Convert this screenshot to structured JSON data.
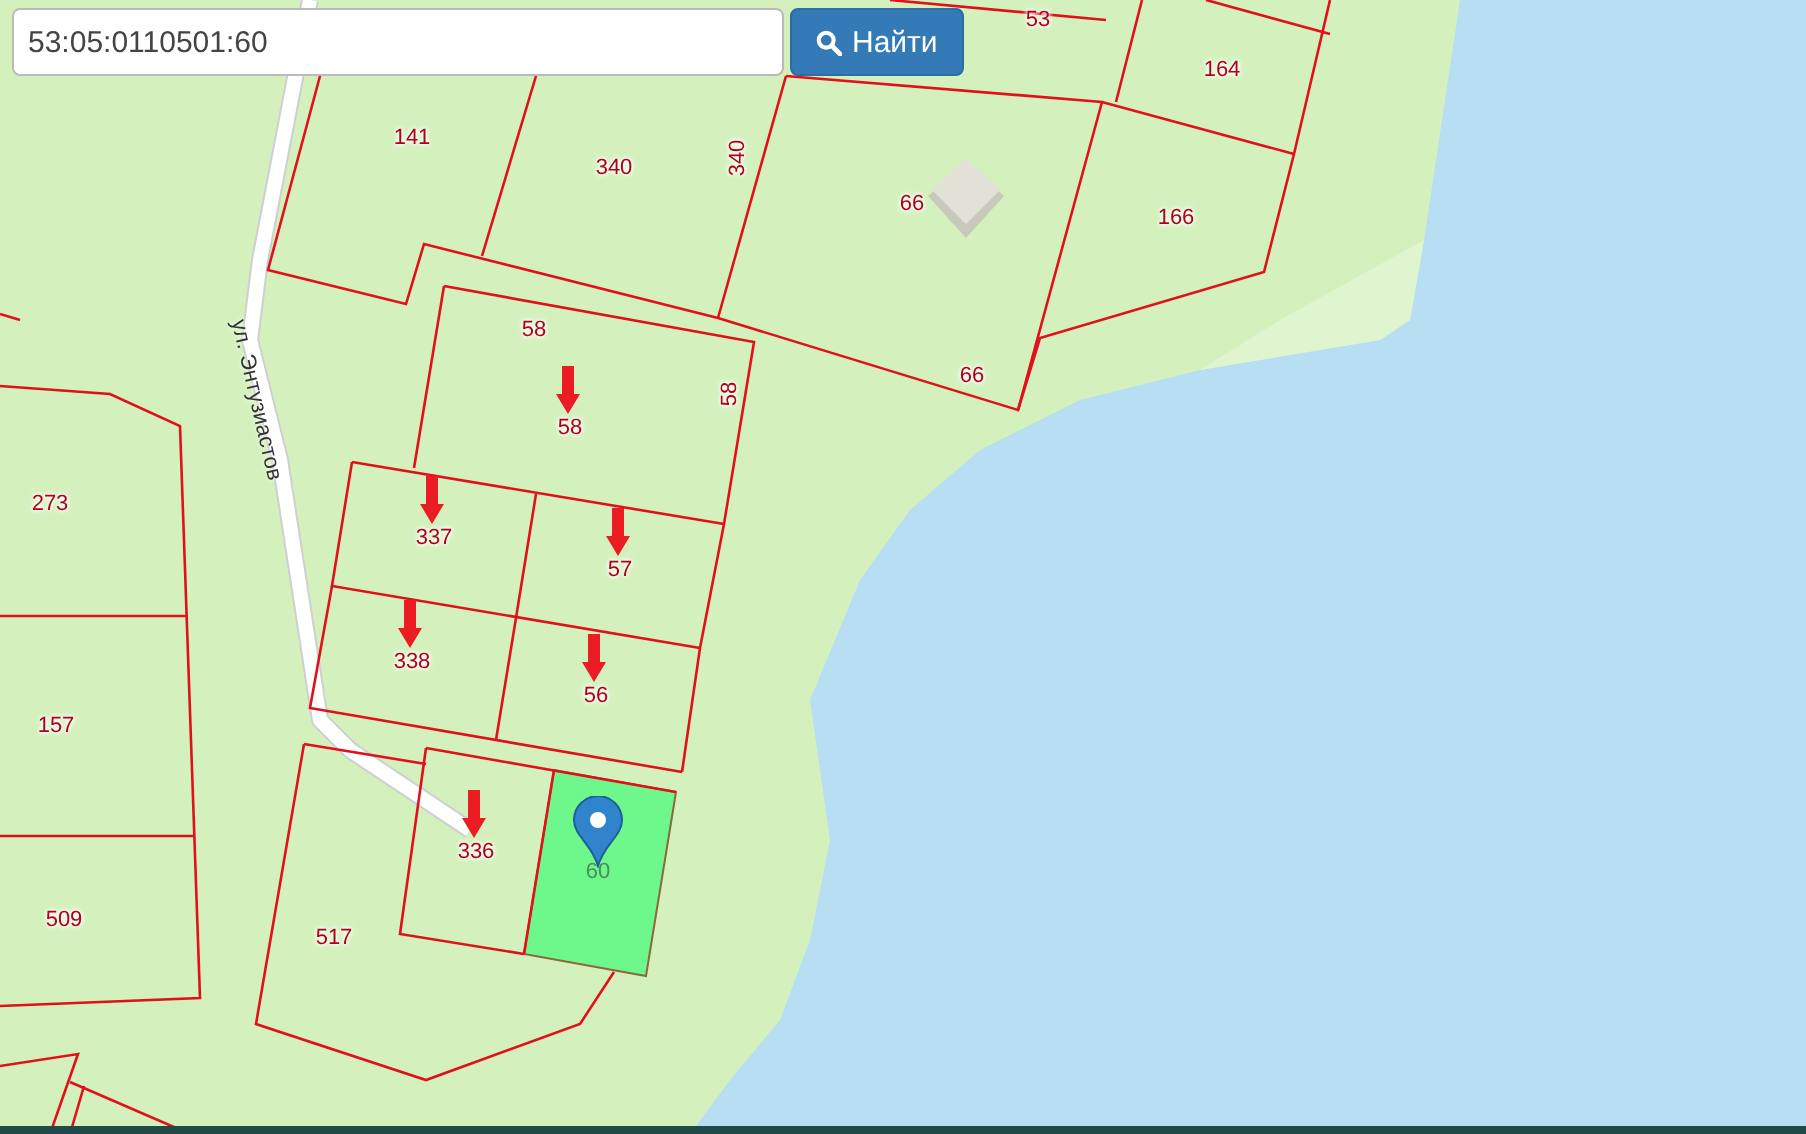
{
  "search": {
    "value": "53:05:0110501:60",
    "button": "Найти"
  },
  "street": "ул. Энтузиастов",
  "labels": [
    {
      "text": "53",
      "marked": false,
      "highlighted": false
    },
    {
      "text": "164",
      "marked": false,
      "highlighted": false
    },
    {
      "text": "141",
      "marked": false,
      "highlighted": false
    },
    {
      "text": "340",
      "marked": false,
      "highlighted": false
    },
    {
      "text": "340",
      "marked": false,
      "highlighted": false
    },
    {
      "text": "66",
      "marked": false,
      "highlighted": false
    },
    {
      "text": "166",
      "marked": false,
      "highlighted": false
    },
    {
      "text": "58",
      "marked": false,
      "highlighted": false
    },
    {
      "text": "58",
      "marked": true,
      "highlighted": false
    },
    {
      "text": "58",
      "marked": false,
      "highlighted": false
    },
    {
      "text": "66",
      "marked": false,
      "highlighted": false
    },
    {
      "text": "273",
      "marked": false,
      "highlighted": false
    },
    {
      "text": "337",
      "marked": true,
      "highlighted": false
    },
    {
      "text": "57",
      "marked": true,
      "highlighted": false
    },
    {
      "text": "338",
      "marked": true,
      "highlighted": false
    },
    {
      "text": "56",
      "marked": true,
      "highlighted": false
    },
    {
      "text": "157",
      "marked": false,
      "highlighted": false
    },
    {
      "text": "336",
      "marked": true,
      "highlighted": false
    },
    {
      "text": "60",
      "marked": false,
      "highlighted": true
    },
    {
      "text": "509",
      "marked": false,
      "highlighted": false
    },
    {
      "text": "517",
      "marked": false,
      "highlighted": false
    }
  ]
}
